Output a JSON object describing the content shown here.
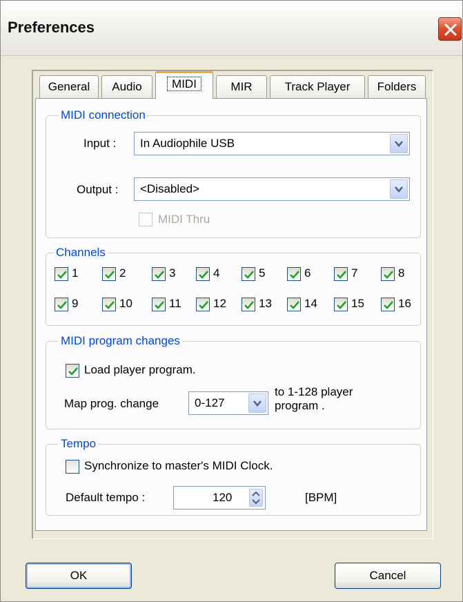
{
  "window": {
    "title": "Preferences"
  },
  "tabs": [
    "General",
    "Audio",
    "MIDI",
    "MIR",
    "Track Player",
    "Folders"
  ],
  "active_tab": "MIDI",
  "midi_connection": {
    "legend": "MIDI connection",
    "input_label": "Input :",
    "input_value": "In Audiophile USB",
    "output_label": "Output :",
    "output_value": "<Disabled>",
    "thru_label": "MIDI Thru"
  },
  "channels": {
    "legend": "Channels",
    "items": [
      "1",
      "2",
      "3",
      "4",
      "5",
      "6",
      "7",
      "8",
      "9",
      "10",
      "11",
      "12",
      "13",
      "14",
      "15",
      "16"
    ]
  },
  "program_changes": {
    "legend": "MIDI program changes",
    "load_label": "Load player program.",
    "map_label": "Map prog. change",
    "map_value": "0-127",
    "to_label_line1": "to 1-128 player",
    "to_label_line2": "program ."
  },
  "tempo": {
    "legend": "Tempo",
    "sync_label": "Synchronize to master's MIDI Clock.",
    "default_label": "Default tempo :",
    "default_value": "120",
    "unit": "[BPM]"
  },
  "buttons": {
    "ok": "OK",
    "cancel": "Cancel"
  },
  "colors": {
    "group_legend": "#0046d5",
    "active_tab_accent": "#f2a640",
    "close": "#d9502f"
  }
}
